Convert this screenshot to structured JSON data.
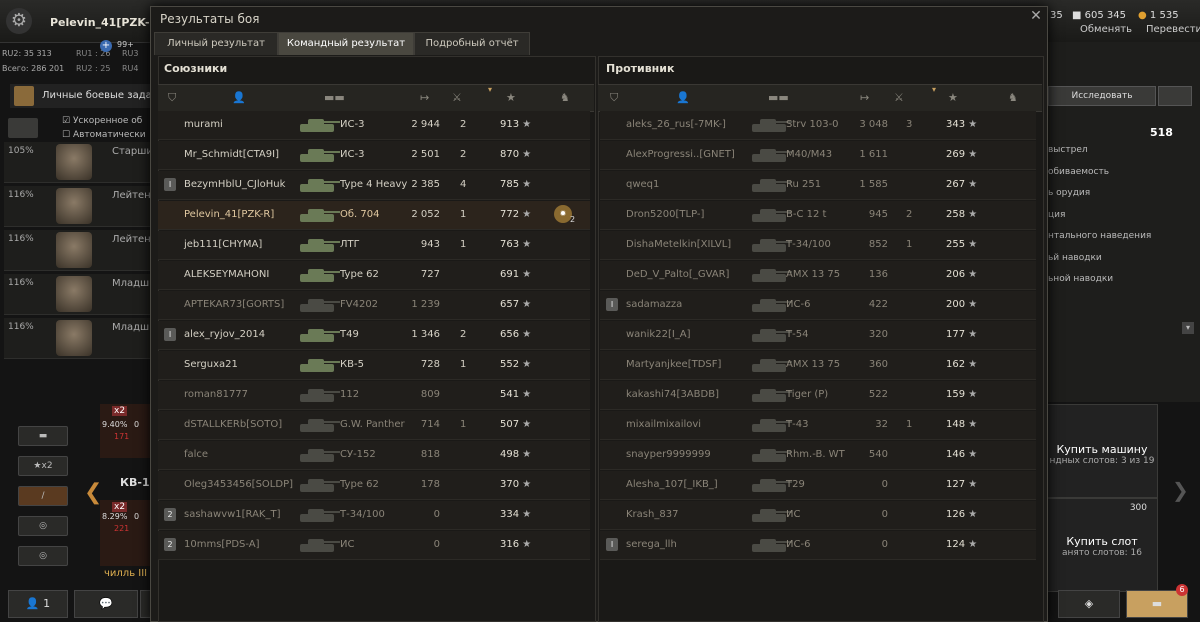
{
  "garage": {
    "player": "Pelevin_41[PZK-R]",
    "stats": [
      "RU2: 35 313",
      "Всего: 286 201"
    ],
    "stats2": [
      "RU1 : 26",
      "RU2 : 25"
    ],
    "stats3": [
      "RU3",
      "RU4"
    ],
    "badge99": "99+",
    "mission": "Личные боевые задач",
    "checkbox1": "Ускоренное об",
    "checkbox2": "Автоматически",
    "crew": [
      {
        "pct": "105%",
        "rank": "Старши"
      },
      {
        "pct": "116%",
        "rank": "Лейтена"
      },
      {
        "pct": "116%",
        "rank": "Лейтена"
      },
      {
        "pct": "116%",
        "rank": "Младши"
      },
      {
        "pct": "116%",
        "rank": "Младши"
      }
    ],
    "credits": "605 345",
    "exchange": "Обменять",
    "gold": "1 535",
    "transfer": "Перевести",
    "goldPartial": "35",
    "research": "Исследовать",
    "xpValue": "518",
    "modules": [
      "выстрел",
      "обиваемость",
      "ь орудия",
      "ция",
      "нтального наведения",
      "ьй наводки",
      "ьной наводки"
    ],
    "buyVehicle": "Купить машину",
    "slots": "ндных слотов: 3 из 19",
    "buySlot": "Купить слот",
    "slotPrice": "300",
    "slotsBusy": "анято слотов: 16",
    "carouselTank1": "КВ-1",
    "carouselTank2": "чилль III",
    "carousel1": {
      "mult": "x2",
      "pct": "9.40%",
      "zero": "0",
      "n": "171"
    },
    "carousel2": {
      "mult": "x2",
      "pct": "8.29%",
      "zero": "0",
      "n": "221"
    },
    "leftX2": "x2",
    "platoonCount": "1",
    "notifCount": "6"
  },
  "modal": {
    "title": "Результаты боя",
    "tabs": [
      "Личный результат",
      "Командный результат",
      "Подробный отчёт"
    ],
    "allyTitle": "Союзники",
    "enemyTitle": "Противник",
    "allies": [
      {
        "name": "murami",
        "tank": "ИС-3",
        "dmg": "2 944",
        "kills": "2",
        "xp": "913",
        "badge": "",
        "state": ""
      },
      {
        "name": "Mr_Schmidt[CTA9I]",
        "tank": "ИС-3",
        "dmg": "2 501",
        "kills": "2",
        "xp": "870",
        "badge": "",
        "state": ""
      },
      {
        "name": "BezymHblU_CJloHuk",
        "tank": "Type 4 Heavy",
        "dmg": "2 385",
        "kills": "4",
        "xp": "785",
        "badge": "I",
        "state": ""
      },
      {
        "name": "Pelevin_41[PZK-R]",
        "tank": "Об. 704",
        "dmg": "2 052",
        "kills": "1",
        "xp": "772",
        "badge": "",
        "state": "self",
        "medal": "2"
      },
      {
        "name": "jeb111[CHYMA]",
        "tank": "ЛТГ",
        "dmg": "943",
        "kills": "1",
        "xp": "763",
        "badge": "",
        "state": ""
      },
      {
        "name": "ALEKSEYMAHONI",
        "tank": "Type 62",
        "dmg": "727",
        "kills": "",
        "xp": "691",
        "badge": "",
        "state": ""
      },
      {
        "name": "APTEKAR73[GORTS]",
        "tank": "FV4202",
        "dmg": "1 239",
        "kills": "",
        "xp": "657",
        "badge": "",
        "state": "dead"
      },
      {
        "name": "alex_ryjov_2014",
        "tank": "T49",
        "dmg": "1 346",
        "kills": "2",
        "xp": "656",
        "badge": "I",
        "state": ""
      },
      {
        "name": "Serguxa21",
        "tank": "КВ-5",
        "dmg": "728",
        "kills": "1",
        "xp": "552",
        "badge": "",
        "state": ""
      },
      {
        "name": "roman81777",
        "tank": "112",
        "dmg": "809",
        "kills": "",
        "xp": "541",
        "badge": "",
        "state": "dead"
      },
      {
        "name": "dSTALLKERb[SOTO]",
        "tank": "G.W. Panther",
        "dmg": "714",
        "kills": "1",
        "xp": "507",
        "badge": "",
        "state": "dead"
      },
      {
        "name": "falce",
        "tank": "СУ-152",
        "dmg": "818",
        "kills": "",
        "xp": "498",
        "badge": "",
        "state": "dead"
      },
      {
        "name": "Oleg3453456[SOLDP]",
        "tank": "Type 62",
        "dmg": "178",
        "kills": "",
        "xp": "370",
        "badge": "",
        "state": "dead"
      },
      {
        "name": "sashawvw1[RAK_T]",
        "tank": "Т-34/100",
        "dmg": "0",
        "kills": "",
        "xp": "334",
        "badge": "2",
        "state": "dead"
      },
      {
        "name": "10mms[PDS-A]",
        "tank": "ИС",
        "dmg": "0",
        "kills": "",
        "xp": "316",
        "badge": "2",
        "state": "dead"
      }
    ],
    "enemies": [
      {
        "name": "aleks_26_rus[-7MK-]",
        "tank": "Strv 103-0",
        "dmg": "3 048",
        "kills": "3",
        "xp": "343",
        "badge": "",
        "state": "dead"
      },
      {
        "name": "AlexProgressi..[GNET]",
        "tank": "M40/M43",
        "dmg": "1 611",
        "kills": "",
        "xp": "269",
        "badge": "",
        "state": "dead"
      },
      {
        "name": "qweq1",
        "tank": "Ru 251",
        "dmg": "1 585",
        "kills": "",
        "xp": "267",
        "badge": "",
        "state": "dead"
      },
      {
        "name": "Dron5200[TLP-]",
        "tank": "B-C 12 t",
        "dmg": "945",
        "kills": "2",
        "xp": "258",
        "badge": "",
        "state": "dead"
      },
      {
        "name": "DishaMetelkin[XILVL]",
        "tank": "Т-34/100",
        "dmg": "852",
        "kills": "1",
        "xp": "255",
        "badge": "",
        "state": "dead"
      },
      {
        "name": "DeD_V_Palto[_GVAR]",
        "tank": "AMX 13 75",
        "dmg": "136",
        "kills": "",
        "xp": "206",
        "badge": "",
        "state": "dead"
      },
      {
        "name": "sadamazza",
        "tank": "ИС-6",
        "dmg": "422",
        "kills": "",
        "xp": "200",
        "badge": "I",
        "state": "dead"
      },
      {
        "name": "wanik22[I_A]",
        "tank": "Т-54",
        "dmg": "320",
        "kills": "",
        "xp": "177",
        "badge": "",
        "state": "dead"
      },
      {
        "name": "Martyanjkee[TDSF]",
        "tank": "AMX 13 75",
        "dmg": "360",
        "kills": "",
        "xp": "162",
        "badge": "",
        "state": "dead"
      },
      {
        "name": "kakashi74[3ABDB]",
        "tank": "Tiger (P)",
        "dmg": "522",
        "kills": "",
        "xp": "159",
        "badge": "",
        "state": "dead"
      },
      {
        "name": "mixailmixailovi",
        "tank": "Т-43",
        "dmg": "32",
        "kills": "1",
        "xp": "148",
        "badge": "",
        "state": "dead"
      },
      {
        "name": "snayper9999999",
        "tank": "Rhm.-B. WT",
        "dmg": "540",
        "kills": "",
        "xp": "146",
        "badge": "",
        "state": "dead"
      },
      {
        "name": "Alesha_107[_IKB_]",
        "tank": "T29",
        "dmg": "0",
        "kills": "",
        "xp": "127",
        "badge": "",
        "state": "dead"
      },
      {
        "name": "Krash_837",
        "tank": "ИС",
        "dmg": "0",
        "kills": "",
        "xp": "126",
        "badge": "",
        "state": "dead"
      },
      {
        "name": "serega_llh",
        "tank": "ИС-6",
        "dmg": "0",
        "kills": "",
        "xp": "124",
        "badge": "I",
        "state": "dead"
      }
    ]
  }
}
